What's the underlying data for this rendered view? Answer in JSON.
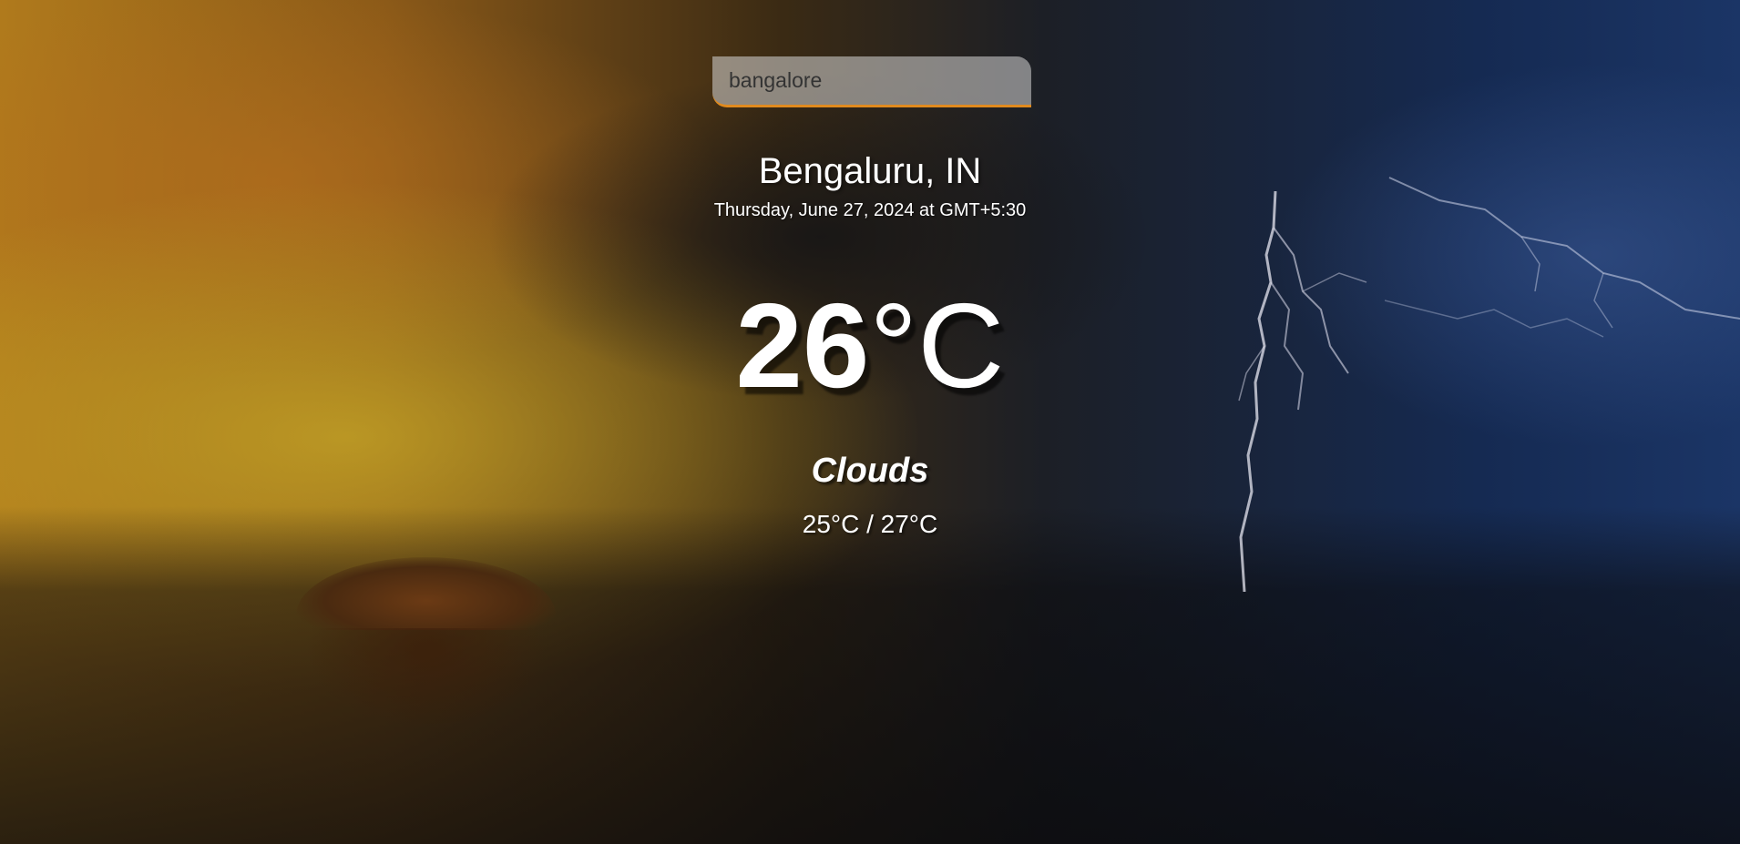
{
  "search": {
    "value": "bangalore",
    "accent_color": "#e08a1e"
  },
  "weather": {
    "location": "Bengaluru, IN",
    "date": "Thursday, June 27, 2024 at GMT+5:30",
    "temperature": "26",
    "temperature_unit": "°C",
    "condition": "Clouds",
    "range": "25°C / 27°C"
  }
}
